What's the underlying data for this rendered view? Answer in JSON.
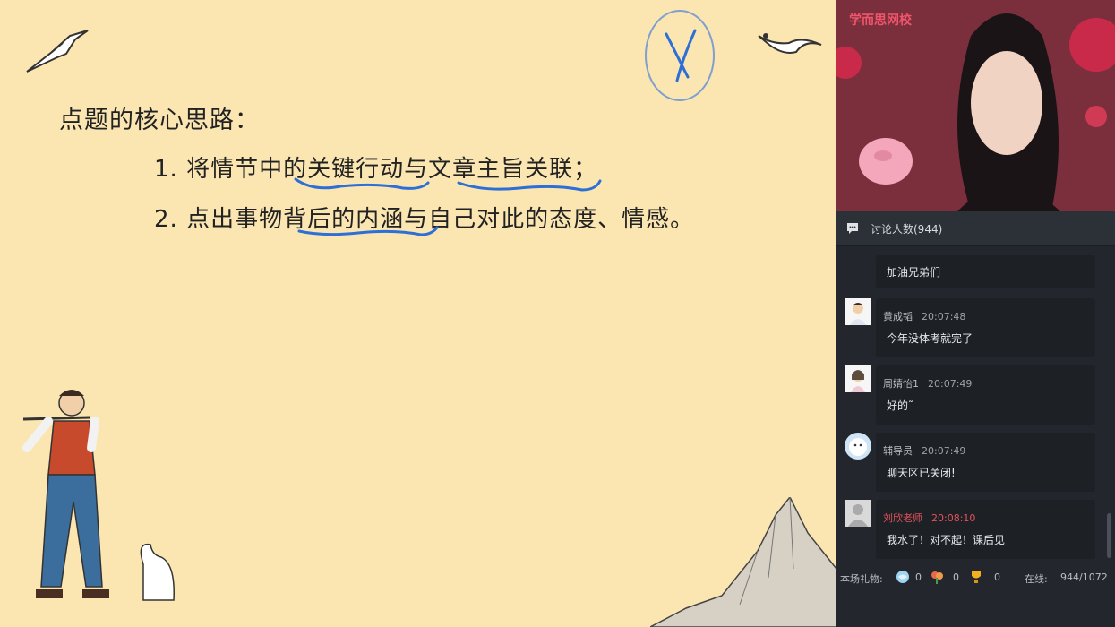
{
  "slide": {
    "title": "点题的核心思路：",
    "points": [
      "1. 将情节中的关键行动与文章主旨关联；",
      "2. 点出事物背后的内涵与自己对此的态度、情感。"
    ]
  },
  "video": {
    "brand": "学而思网校"
  },
  "chat": {
    "header_title": "讨论人数(944)",
    "messages": [
      {
        "name": "",
        "time": "",
        "text": "加油兄弟们"
      },
      {
        "name": "黄成韬",
        "time": "20:07:48",
        "text": "今年没体考就完了"
      },
      {
        "name": "周婧怡1",
        "time": "20:07:49",
        "text": "好的˜"
      },
      {
        "name": "辅导员",
        "time": "20:07:49",
        "text": "聊天区已关闭!"
      },
      {
        "name": "刘欣老师",
        "time": "20:08:10",
        "text": "我水了！对不起！课后见"
      }
    ]
  },
  "footer": {
    "gifts_label": "本场礼物:",
    "gift_counts": [
      "0",
      "0",
      "0"
    ],
    "online_label": "在线:",
    "online_value": "944/1072"
  },
  "colors": {
    "slide_bg": "#fbe6b2",
    "panel_bg": "#23272d",
    "underline_blue": "#2d6fd6",
    "teacher_red": "#e2535c"
  }
}
